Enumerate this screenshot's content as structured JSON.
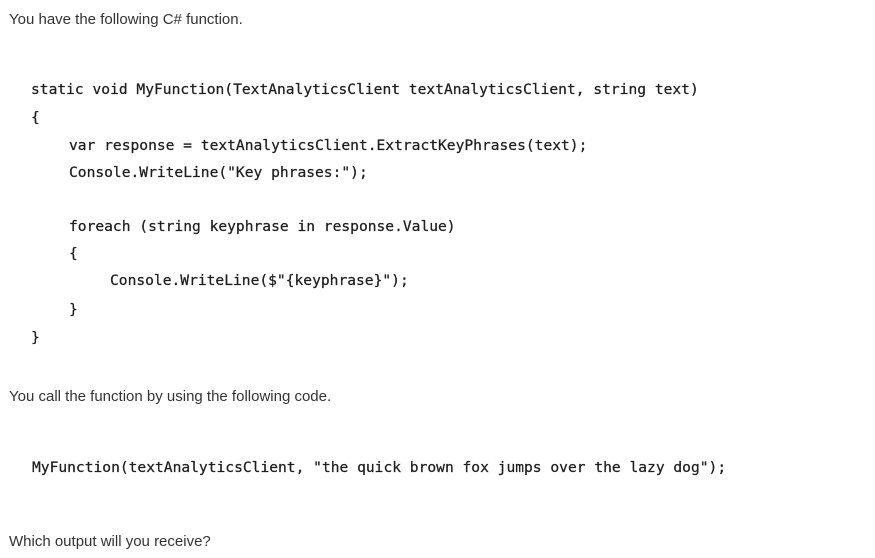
{
  "intro_text": "You have the following C# function.",
  "function_code": {
    "signature": "static void MyFunction(TextAnalyticsClient textAnalyticsClient, string text)",
    "open_brace": "{",
    "line_response": "var response = textAnalyticsClient.ExtractKeyPhrases(text);",
    "line_writeline": "Console.WriteLine(\"Key phrases:\");",
    "line_foreach": "foreach (string keyphrase in response.Value)",
    "inner_open_brace": "{",
    "line_inner_writeline": "Console.WriteLine($\"{keyphrase}\");",
    "inner_close_brace": "}",
    "close_brace": "}"
  },
  "call_intro_text": "You call the function by using the following code.",
  "call_code": "MyFunction(textAnalyticsClient, \"the quick brown fox jumps over the lazy dog\");",
  "question_text": "Which output will you receive?"
}
